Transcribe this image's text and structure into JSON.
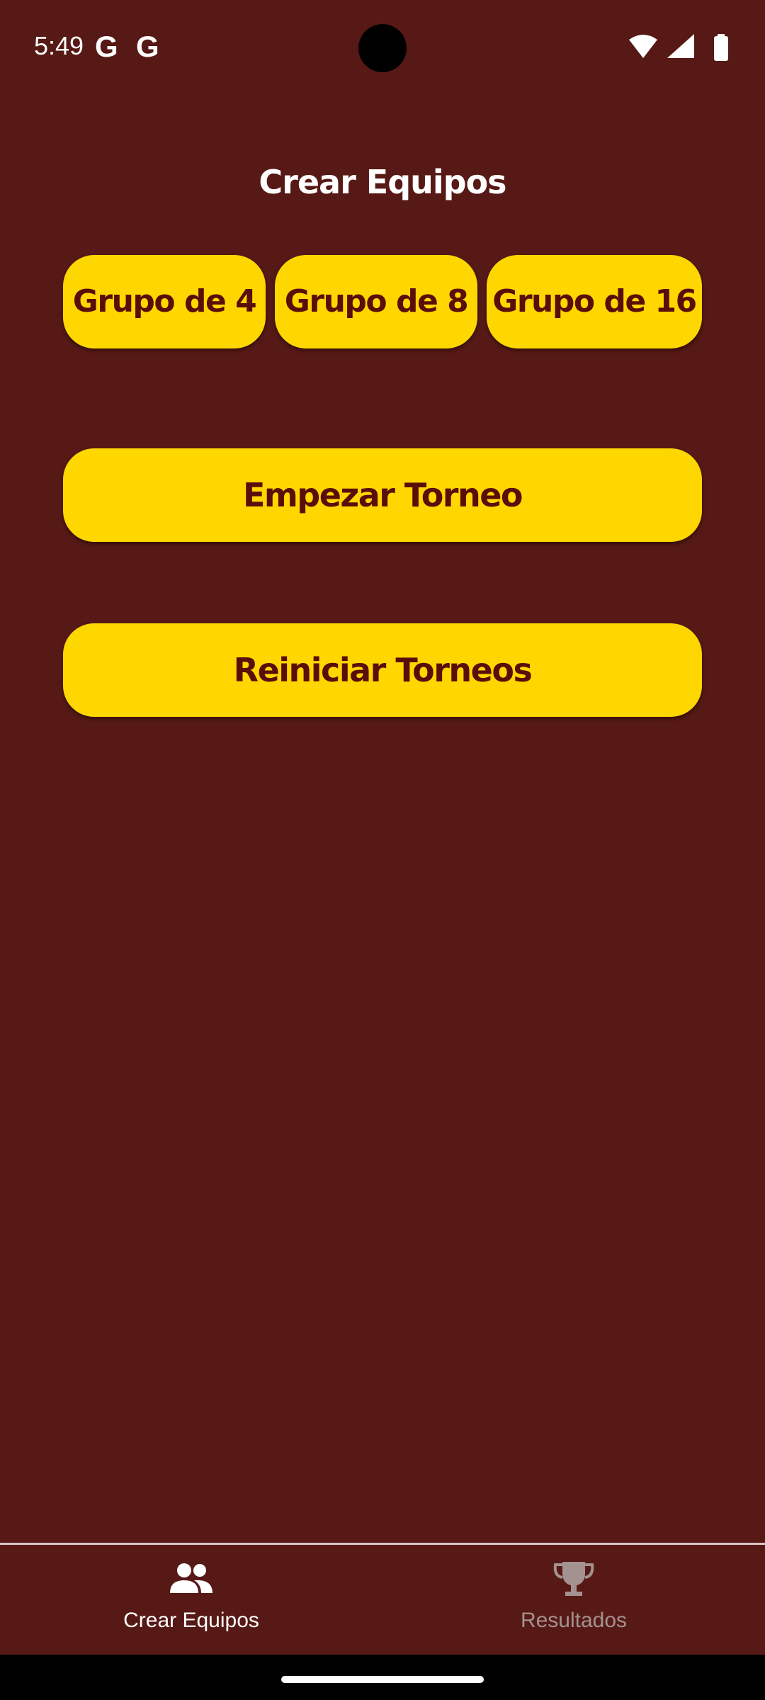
{
  "status_bar": {
    "time": "5:49",
    "notification_icons": [
      "google-g-icon",
      "google-g-icon"
    ],
    "g_glyph": "G"
  },
  "screen": {
    "title": "Crear Equipos"
  },
  "group_buttons": [
    {
      "label": "Grupo de 4"
    },
    {
      "label": "Grupo de 8"
    },
    {
      "label": "Grupo de 16"
    }
  ],
  "actions": {
    "start_label": "Empezar Torneo",
    "reset_label": "Reiniciar Torneos"
  },
  "bottom_nav": {
    "items": [
      {
        "label": "Crear Equipos",
        "icon": "people-icon",
        "active": true
      },
      {
        "label": "Resultados",
        "icon": "trophy-icon",
        "active": false
      }
    ]
  },
  "colors": {
    "background": "#571915",
    "button": "#FFD700",
    "button_text": "#5a0e09",
    "nav_inactive": "#a39290"
  }
}
